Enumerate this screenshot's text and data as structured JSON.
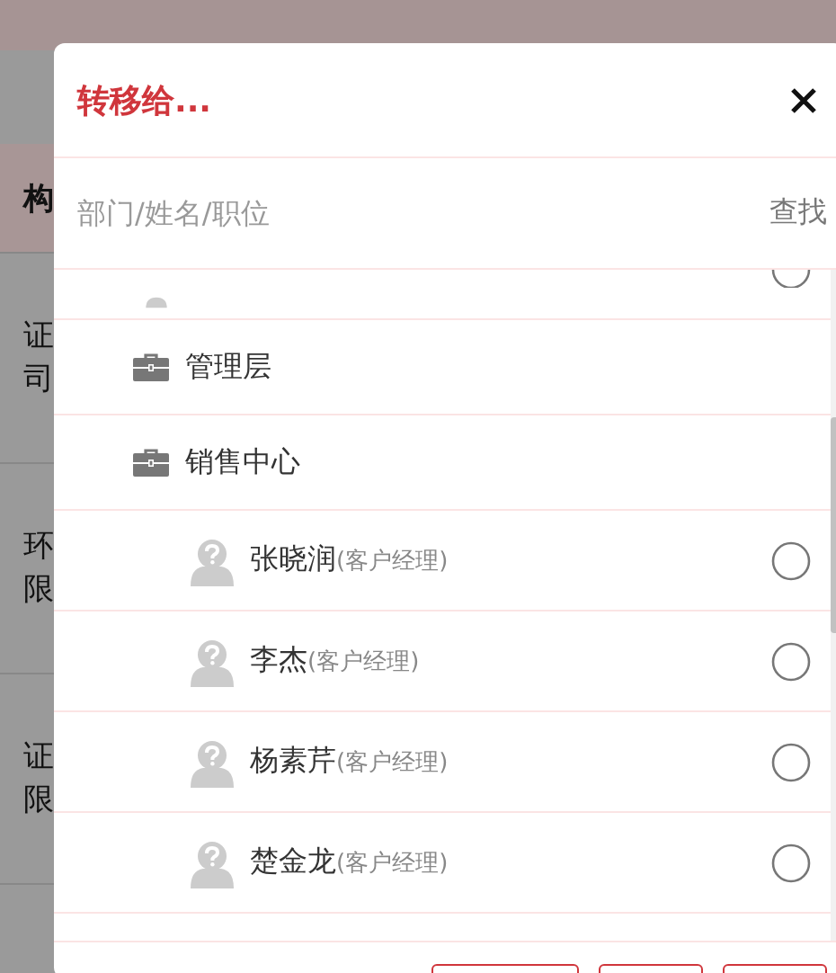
{
  "background": {
    "header": "构",
    "rows": [
      [
        "证",
        "司"
      ],
      [
        "环",
        "限"
      ],
      [
        "证",
        "限"
      ]
    ]
  },
  "dialog": {
    "title": "转移给...",
    "search": {
      "placeholder": "部门/姓名/职位",
      "button": "查找"
    },
    "partial_row": {
      "selected": false
    },
    "tree": [
      {
        "kind": "group",
        "name": "管理层"
      },
      {
        "kind": "group",
        "name": "销售中心",
        "children": [
          {
            "kind": "person",
            "name": "张晓润",
            "role": "(客户经理)",
            "selected": false
          },
          {
            "kind": "person",
            "name": "李杰",
            "role": "(客户经理)",
            "selected": false
          },
          {
            "kind": "person",
            "name": "杨素芹",
            "role": "(客户经理)",
            "selected": false
          },
          {
            "kind": "person",
            "name": "楚金龙",
            "role": "(客户经理)",
            "selected": false
          }
        ]
      }
    ]
  }
}
